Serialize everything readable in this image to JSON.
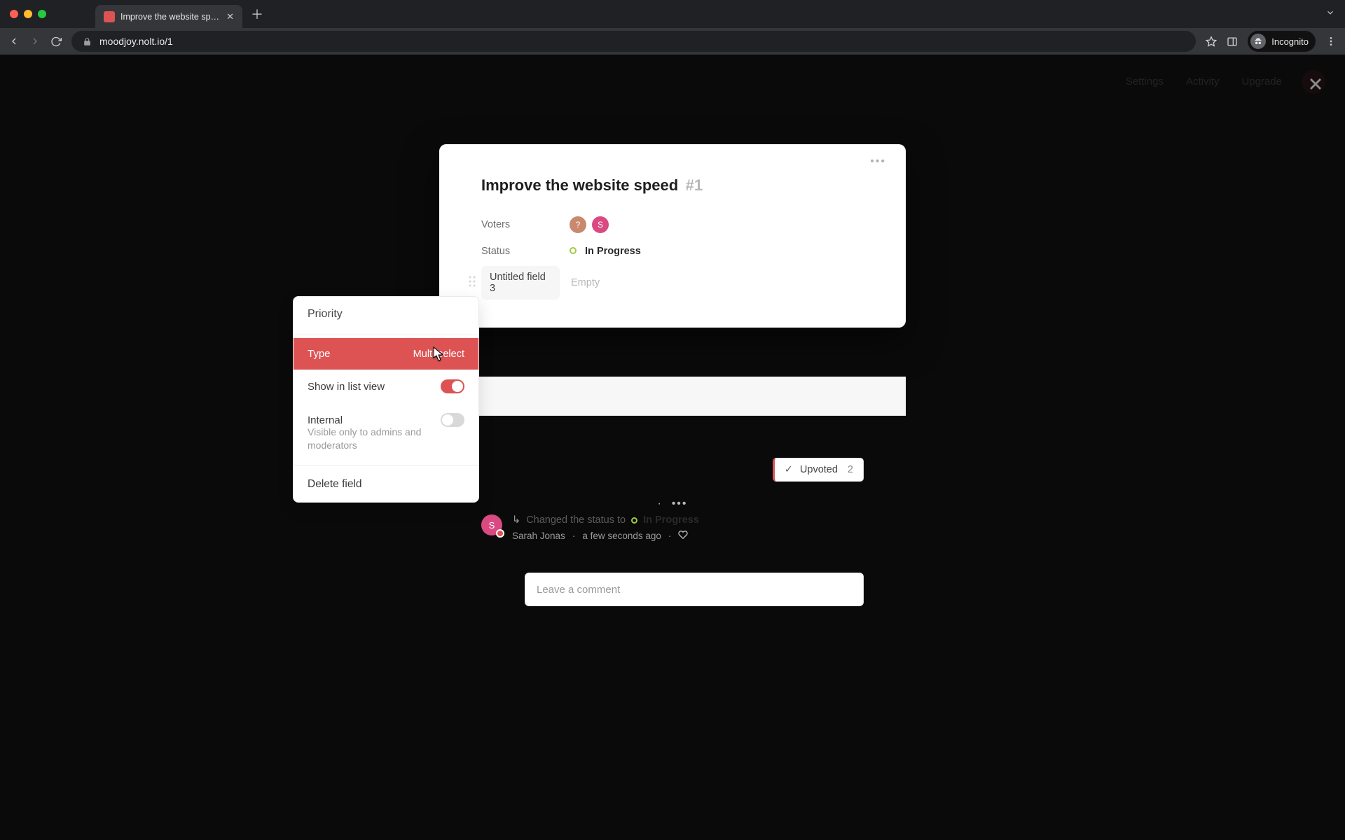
{
  "browser": {
    "tab_title": "Improve the website speed · M",
    "url": "moodjoy.nolt.io/1",
    "incognito_label": "Incognito"
  },
  "page_nav": {
    "links": [
      "Settings",
      "Activity",
      "Upgrade"
    ]
  },
  "modal": {
    "title": "Improve the website speed",
    "issue_number": "#1",
    "fields": {
      "voters_label": "Voters",
      "voters": [
        {
          "initial": "?",
          "color": "#c8896e"
        },
        {
          "initial": "S",
          "color": "#d94a82"
        }
      ],
      "status_label": "Status",
      "status_value": "In Progress",
      "custom_field_name": "Untitled field 3",
      "custom_field_value": "Empty"
    },
    "upvote": {
      "label": "Upvoted",
      "count": 2
    },
    "activity": {
      "avatar_initial": "S",
      "line_prefix": "Changed the status to",
      "line_status": "In Progress",
      "author": "Sarah Jonas",
      "time": "a few seconds ago"
    },
    "comment_placeholder": "Leave a comment"
  },
  "field_dropdown": {
    "name_input": "Priority",
    "type_label": "Type",
    "type_value": "Multi-select",
    "show_in_list_label": "Show in list view",
    "show_in_list_on": true,
    "internal_label": "Internal",
    "internal_on": false,
    "internal_desc": "Visible only to admins and moderators",
    "delete_label": "Delete field"
  }
}
